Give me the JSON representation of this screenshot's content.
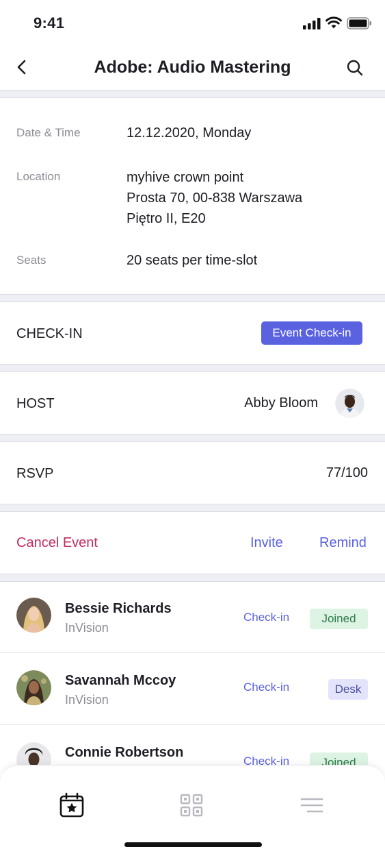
{
  "status_bar": {
    "time": "9:41"
  },
  "nav": {
    "title": "Adobe: Audio Mastering"
  },
  "details": {
    "date_label": "Date & Time",
    "date_value": "12.12.2020, Monday",
    "location_label": "Location",
    "location_lines": [
      "myhive crown point",
      "Prosta 70, 00-838 Warszawa",
      "Piętro II, E20"
    ],
    "seats_label": "Seats",
    "seats_value": "20 seats per time-slot"
  },
  "checkin": {
    "label": "CHECK-IN",
    "button": "Event Check-in"
  },
  "host": {
    "label": "HOST",
    "name": "Abby Bloom"
  },
  "rsvp": {
    "label": "RSVP",
    "value": "77/100"
  },
  "actions": {
    "cancel": "Cancel Event",
    "invite": "Invite",
    "remind": "Remind"
  },
  "attendees": [
    {
      "name": "Bessie Richards",
      "org": "InVision",
      "action": "Check-in",
      "status": "Joined"
    },
    {
      "name": "Savannah Mccoy",
      "org": "InVision",
      "action": "Check-in",
      "status": "Desk"
    },
    {
      "name": "Connie Robertson",
      "org": "",
      "action": "Check-in",
      "status": "Joined"
    }
  ],
  "tabs": [
    {
      "icon": "calendar-star-icon",
      "active": true
    },
    {
      "icon": "qr-grid-icon",
      "active": false
    },
    {
      "icon": "menu-icon",
      "active": false
    }
  ],
  "colors": {
    "accent": "#5a62e0",
    "danger": "#c52b5f",
    "joined_bg": "#ddf3e4",
    "desk_bg": "#e3e4fb"
  }
}
